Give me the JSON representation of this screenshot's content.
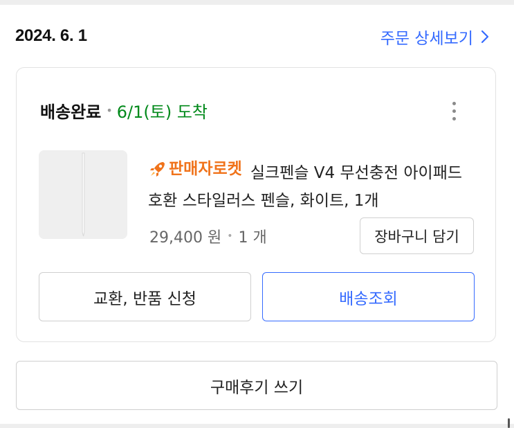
{
  "order": {
    "date": "2024. 6. 1",
    "detail_link": "주문 상세보기"
  },
  "shipment": {
    "status": "배송완료",
    "arrival": "6/1(토) 도착"
  },
  "product": {
    "badge": "판매자로켓",
    "name": "실크펜슬 V4 무선충전 아이패드 호환 스타일러스 펜슬, 화이트, 1개",
    "price": "29,400 원",
    "quantity": "1 개"
  },
  "buttons": {
    "add_to_cart": "장바구니 담기",
    "exchange_return": "교환, 반품 신청",
    "track_delivery": "배송조회",
    "write_review": "구매후기 쓰기"
  },
  "colors": {
    "accent_blue": "#346aff",
    "arrival_green": "#00891a",
    "rocket_orange": "#f0731b"
  },
  "icons": {
    "detail_link": "chevron-right-icon",
    "more": "more-vertical-icon",
    "badge": "rocket-icon"
  }
}
